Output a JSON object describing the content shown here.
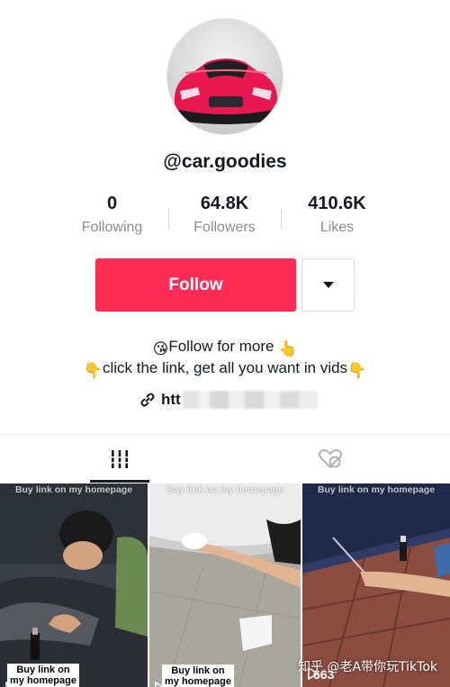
{
  "profile": {
    "username": "@car.goodies",
    "avatar_icon": "red-sports-car-avatar"
  },
  "stats": [
    {
      "value": "0",
      "label": "Following"
    },
    {
      "value": "64.8K",
      "label": "Followers"
    },
    {
      "value": "410.6K",
      "label": "Likes"
    }
  ],
  "actions": {
    "follow_label": "Follow",
    "follow_color": "#fe2c55",
    "more_icon": "caret-down-icon"
  },
  "bio": {
    "line1": "Follow for more",
    "line1_emoji_before": "😘",
    "line1_emoji_after": "👆",
    "line2": "click the link, get all you want in vids",
    "line2_emoji_before": "👇",
    "line2_emoji_after": "👇",
    "link_text": "htt"
  },
  "tabs": [
    {
      "name": "videos",
      "icon": "grid-icon",
      "active": true
    },
    {
      "name": "liked",
      "icon": "liked-heart-icon",
      "active": false
    }
  ],
  "videos": [
    {
      "caption": "Buy link on my homepage",
      "label_line1": "Buy link on",
      "label_line2": "my homepage",
      "play_count": ""
    },
    {
      "caption": "Buy link on my homepage",
      "label_line1": "Buy link on",
      "label_line2": "my homepage",
      "play_count": ""
    },
    {
      "caption": "Buy link on my homepage",
      "play_count": "663"
    }
  ],
  "watermark": "知乎 @老A带你玩TikTok"
}
